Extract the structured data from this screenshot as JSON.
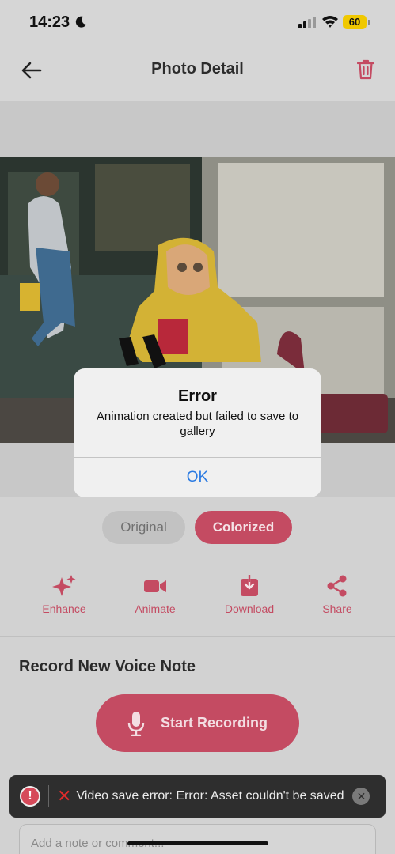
{
  "status_bar": {
    "time": "14:23",
    "battery": "60"
  },
  "header": {
    "title": "Photo Detail"
  },
  "toggle": {
    "original_label": "Original",
    "colorized_label": "Colorized"
  },
  "actions": [
    {
      "label": "Enhance",
      "icon": "sparkles-icon"
    },
    {
      "label": "Animate",
      "icon": "video-camera-icon"
    },
    {
      "label": "Download",
      "icon": "download-icon"
    },
    {
      "label": "Share",
      "icon": "share-icon"
    }
  ],
  "voice": {
    "title": "Record New Voice Note",
    "record_label": "Start Recording"
  },
  "note": {
    "placeholder": "Add a note or comment..."
  },
  "toast": {
    "text": "Video save error: Error: Asset couldn't be saved"
  },
  "dialog": {
    "title": "Error",
    "message": "Animation created but failed to save to gallery",
    "ok_label": "OK"
  },
  "colors": {
    "accent": "#c44b62",
    "link_blue": "#2a7ae2",
    "dialog_bg": "#f0f0f0",
    "toast_bg": "#2e2e2e"
  }
}
